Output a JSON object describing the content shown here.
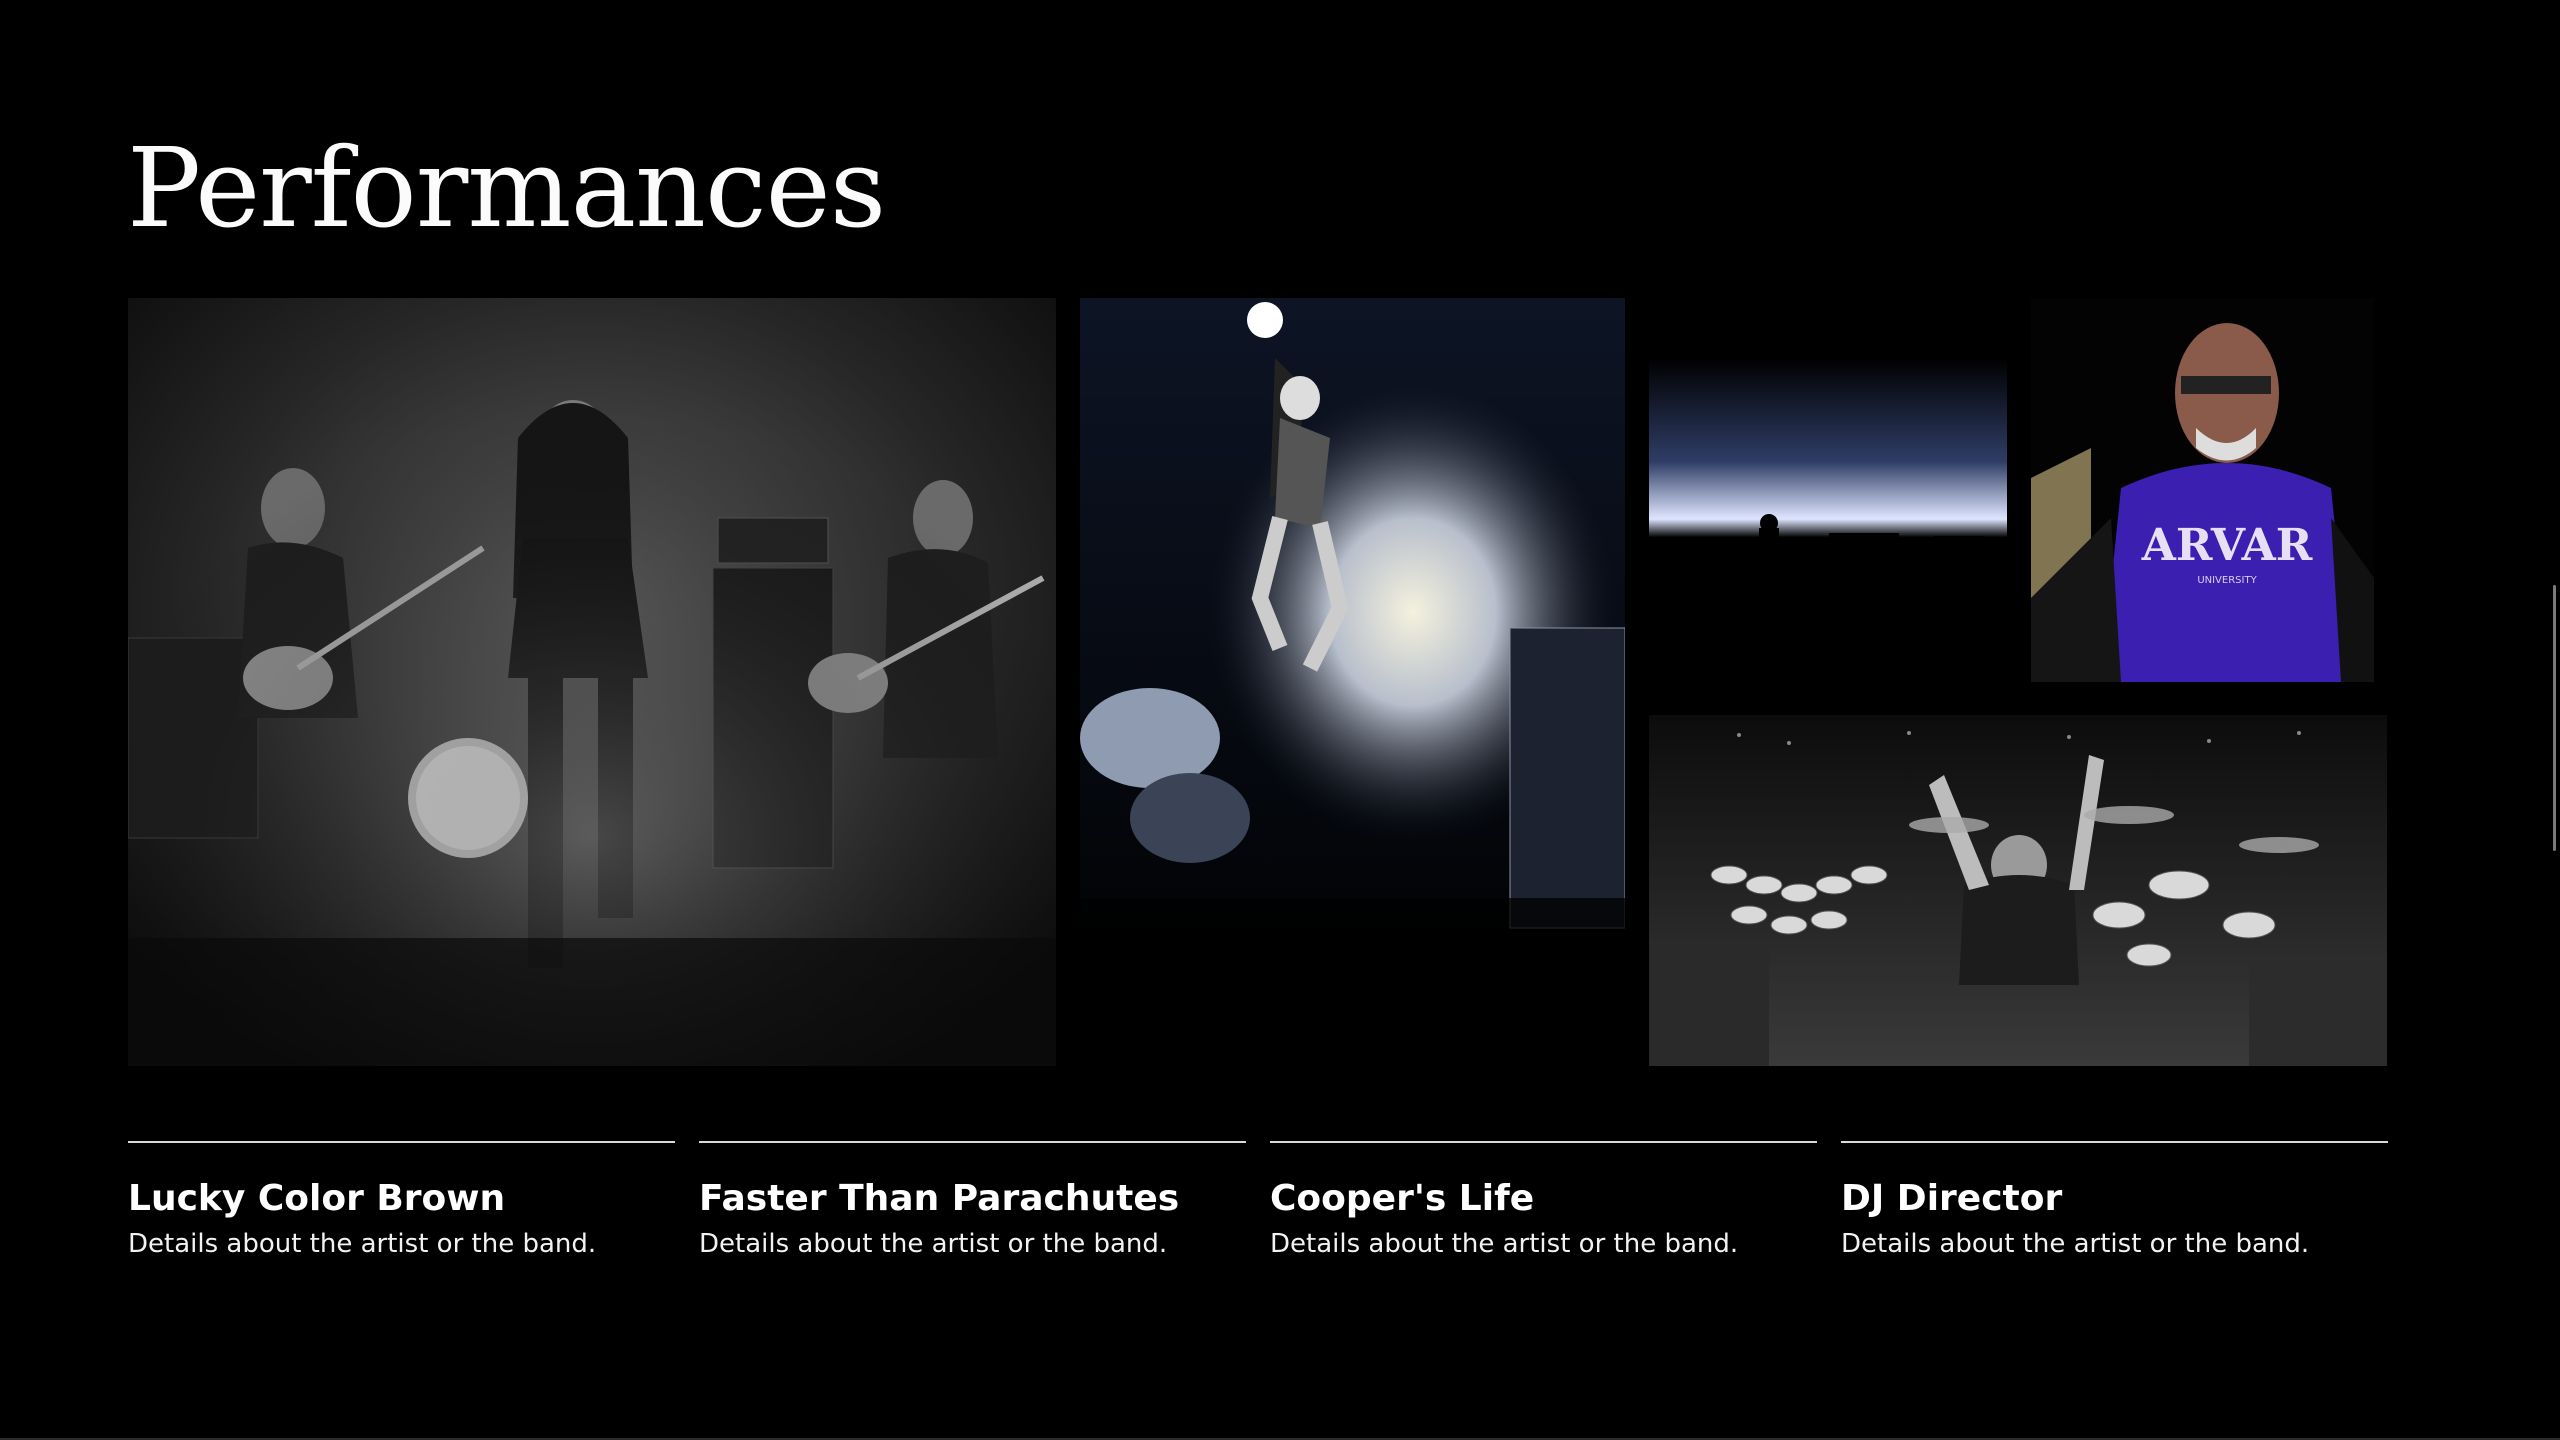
{
  "page": {
    "title": "Performances"
  },
  "gallery": {
    "photos": [
      {
        "name": "band-on-stage-photo"
      },
      {
        "name": "jumping-singer-photo"
      },
      {
        "name": "backlit-stage-photo"
      },
      {
        "name": "harvard-hoodie-portrait-photo"
      },
      {
        "name": "drummer-kit-photo"
      }
    ]
  },
  "performers": [
    {
      "title": "Lucky Color Brown",
      "description": "Details about the artist or the band."
    },
    {
      "title": "Faster Than Parachutes",
      "description": "Details about the artist or the band."
    },
    {
      "title": "Cooper's Life",
      "description": "Details about the artist or the band."
    },
    {
      "title": "DJ Director",
      "description": "Details about the artist or the band."
    }
  ],
  "colors": {
    "background": "#000000",
    "text": "#ffffff",
    "divider": "#d9d9d9",
    "hoodie": "#3a1fb0"
  }
}
